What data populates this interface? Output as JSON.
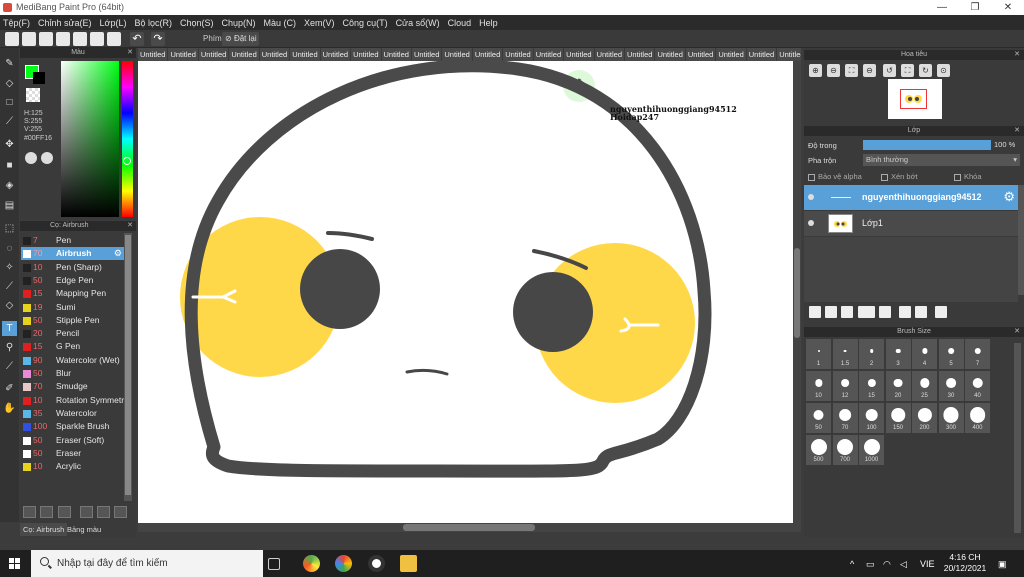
{
  "window": {
    "title": "MediBang Paint Pro (64bit)",
    "minimize": "—",
    "maximize": "❐",
    "close": "✕"
  },
  "menu": [
    "Tệp(F)",
    "Chỉnh sửa(E)",
    "Lớp(L)",
    "Bộ lọc(R)",
    "Chọn(S)",
    "Chụp(N)",
    "Màu (C)",
    "Xem(V)",
    "Công cụ(T)",
    "Cửa sổ(W)",
    "Cloud",
    "Help"
  ],
  "toolbar": {
    "key_label": "Phím",
    "reset_label": "Đặt lại",
    "undo": "↶",
    "redo": "↷"
  },
  "color_panel": {
    "title": "Màu",
    "h": "H:125",
    "s": "S:255",
    "v": "V:255",
    "hex": "#00FF16"
  },
  "brush_panel": {
    "title": "Cọ: Airbrush",
    "brushes": [
      {
        "size": "7",
        "name": "Pen",
        "color": "#222222"
      },
      {
        "size": "70",
        "name": "Airbrush",
        "color": "#ffffff",
        "selected": true
      },
      {
        "size": "10",
        "name": "Pen (Sharp)",
        "color": "#222222"
      },
      {
        "size": "50",
        "name": "Edge Pen",
        "color": "#222222"
      },
      {
        "size": "15",
        "name": "Mapping Pen",
        "color": "#e02020"
      },
      {
        "size": "19",
        "name": "Sumi",
        "color": "#e8d21c"
      },
      {
        "size": "50",
        "name": "Stipple Pen",
        "color": "#e8d21c"
      },
      {
        "size": "20",
        "name": "Pencil",
        "color": "#222222"
      },
      {
        "size": "15",
        "name": "G Pen",
        "color": "#e02020"
      },
      {
        "size": "90",
        "name": "Watercolor (Wet)",
        "color": "#5ab8e8"
      },
      {
        "size": "50",
        "name": "Blur",
        "color": "#e88ad8"
      },
      {
        "size": "70",
        "name": "Smudge",
        "color": "#e8c8c8"
      },
      {
        "size": "10",
        "name": "Rotation Symmetry",
        "color": "#e02020"
      },
      {
        "size": "35",
        "name": "Watercolor",
        "color": "#5ab8e8"
      },
      {
        "size": "100",
        "name": "Sparkle Brush",
        "color": "#3050e0"
      },
      {
        "size": "50",
        "name": "Eraser (Soft)",
        "color": "#ffffff"
      },
      {
        "size": "50",
        "name": "Eraser",
        "color": "#ffffff"
      },
      {
        "size": "10",
        "name": "Acrylic",
        "color": "#e8d21c"
      }
    ],
    "tabs": [
      "Cọ: Airbrush",
      "Bảng màu"
    ]
  },
  "canvas": {
    "tabs": [
      "Untitled",
      "Untitled",
      "Untitled",
      "Untitled",
      "Untitled",
      "Untitled",
      "Untitled",
      "Untitled",
      "Untitled",
      "Untitled",
      "Untitled",
      "Untitled",
      "Untitled",
      "Untitled",
      "Untitled",
      "Untitled",
      "Untitled",
      "Untitled",
      "Untitled",
      "Untitled",
      "Untitled",
      "Untitled",
      "Untitled"
    ],
    "text_line1": "nguyenthihuonggiang94512",
    "text_line2": "Hoidap247"
  },
  "navigator": {
    "title": "Hoa tiêu"
  },
  "layers": {
    "title": "Lớp",
    "opacity_label": "Độ trong",
    "opacity_value": "100 %",
    "opacity_fraction": 1.0,
    "blend_label": "Pha trộn",
    "blend_value": "Bình thường",
    "protect_alpha": "Bảo vệ alpha",
    "clipping": "Xén bớt",
    "lock": "Khóa",
    "list": [
      {
        "name": "nguyenthihuonggiang94512",
        "selected": true
      },
      {
        "name": "Lớp1",
        "selected": false
      }
    ]
  },
  "brush_size": {
    "title": "Brush Size",
    "sizes": [
      "1",
      "1.5",
      "2",
      "3",
      "4",
      "5",
      "7",
      "10",
      "12",
      "15",
      "20",
      "25",
      "30",
      "40",
      "50",
      "70",
      "100",
      "150",
      "200",
      "300",
      "400",
      "500",
      "700",
      "1000"
    ]
  },
  "taskbar": {
    "search_placeholder": "Nhập tại đây để tìm kiếm",
    "lang": "VIE",
    "time": "4:16 CH",
    "date": "20/12/2021"
  },
  "colors": {
    "accent": "#5aa0d8",
    "cheek": "#ffd84a",
    "outline": "#4a4a4a",
    "fg": "#00ff16"
  }
}
